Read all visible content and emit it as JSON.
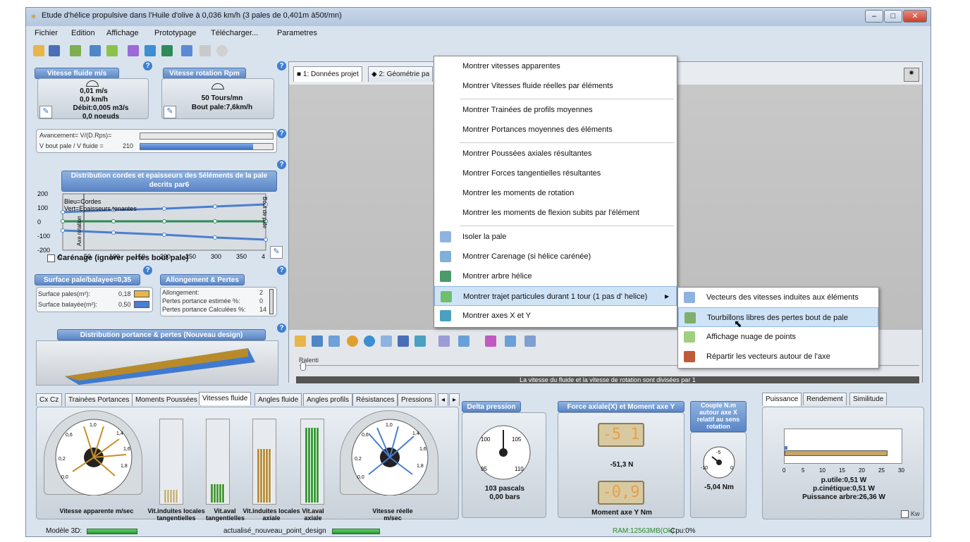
{
  "window": {
    "title": "Etude d'hélice propulsive dans l'Huile d'olive à 0,036 km/h (3 pales de 0,401m à50t/mn)",
    "menus": [
      "Fichier",
      "Edition",
      "Affichage",
      "Prototypage",
      "Télécharger...",
      "Parametres"
    ]
  },
  "fluid_speed": {
    "title": "Vitesse fluide m/s",
    "line1": "0,01 m/s",
    "line2": "0,0 km/h",
    "line3": "Débit:0,005 m3/s",
    "line4": "0,0 noeuds"
  },
  "rotation_speed": {
    "title": "Vitesse rotation Rpm",
    "line1": "50 Tours/mn",
    "line2": "Bout pale:7,6km/h"
  },
  "advance": {
    "label1": "Avancement= V/(D.Rps)=",
    "label2": "V bout pale / V fluide =",
    "value2": "210",
    "bar2_fill": 0.85
  },
  "distribution": {
    "title": "Distribution cordes et epaisseurs des 5éléments de la pale decrits par6",
    "legend1": "Bleu=Cordes",
    "legend2": "Vert=Epaisseurs tenantes",
    "yticks": [
      "200",
      "100",
      "0",
      "-100",
      "-200"
    ],
    "xticks": [
      "0",
      "50",
      "100",
      "150",
      "200",
      "250",
      "300",
      "350",
      "4"
    ],
    "left_label": "Axe rotation",
    "right_label": "Bout de pale",
    "checkbox_label": "Carénage (ignorer pertes bout pale)"
  },
  "chart_data": {
    "type": "line",
    "x": [
      0,
      100,
      200,
      300,
      400
    ],
    "series": [
      {
        "name": "Bleu=Cordes",
        "values": [
          70,
          85,
          95,
          110,
          125
        ]
      },
      {
        "name": "Vert=Epaisseurs tenantes",
        "values": [
          5,
          5,
          5,
          5,
          5
        ]
      },
      {
        "values": [
          -60,
          -75,
          -90,
          -110,
          -125
        ]
      }
    ],
    "xlim": [
      0,
      400
    ],
    "ylim": [
      -200,
      200
    ]
  },
  "surface": {
    "title": "Surface pale/balayee=0,35",
    "label1": "Surface pales(m²):",
    "value1": "0,18",
    "label2": "Surface balayée(m²):",
    "value2": "0,50"
  },
  "allongement": {
    "title": "Allongement & Pertes",
    "label1": "Allongement:",
    "value1": "2",
    "label2": "Pertes portance estimée %:",
    "value2": "0",
    "label3": "Pertes portance Calculées %:",
    "value3": "14"
  },
  "portance": {
    "title": "Distribution portance & pertes (Nouveau design)"
  },
  "viewer": {
    "tabs": [
      "1: Données projet",
      "2: Géométrie pa"
    ],
    "slider_label": "Ralenti",
    "footer": "La vitesse du fluide et la vitesse de rotation sont divisées par 1"
  },
  "context_menu": {
    "items": [
      "Montrer vitesses apparentes",
      "Montrer Vitesses fluide réelles par éléments",
      "Montrer Trainées de profils moyennes",
      "Montrer Portances  moyennes des éléments",
      "Montrer Poussées axiales résultantes",
      "Montrer Forces tangentielles résultantes",
      "Montrer les moments de rotation",
      "Montrer les moments de flexion subits par l'élément",
      "Isoler la pale",
      "Montrer Carenage (si hélice carénée)",
      "Montrer arbre hélice",
      "Montrer trajet particules durant 1 tour (1 pas d' helice)",
      "Montrer axes X et Y"
    ],
    "submenu": [
      "Vecteurs des vitesses induites aux éléments",
      "Tourbillons libres des pertes bout de pale",
      "Affichage nuage de points",
      "Répartir les vecteurs autour de l'axe"
    ]
  },
  "bottom_tabs": [
    "Cx Cz",
    "Trainées Portances",
    "Moments Poussées",
    "Vitesses fluide",
    "Angles fluide",
    "Angles profils",
    "Résistances",
    "Pressions"
  ],
  "speeds": {
    "gauge_ticks": [
      "0,0",
      "0,2",
      "0,6",
      "1,0",
      "1,4",
      "1,6",
      "1,8"
    ],
    "label_apparent": "Vitesse apparente m/sec",
    "label_ind_tan": "Vit.induites locales tangentielles",
    "label_aval_tan": "Vit.aval tangentielles",
    "label_ind_ax": "Vit.induites locales axiale",
    "label_aval_ax": "Vit.aval axiale",
    "label_real": "Vitesse réelle m/sec"
  },
  "pressure": {
    "title": "Delta pression",
    "ticks": [
      "95",
      "100",
      "105",
      "110"
    ],
    "line1": "103 pascals",
    "line2": "0,00 bars"
  },
  "force": {
    "title": "Force axiale(X) et Moment axe Y",
    "digits1": "-5 1",
    "value1": "-51,3 N",
    "digits2": "-0,9",
    "label2": "Moment axe Y Nm"
  },
  "couple": {
    "title": "Couple N.m autour axe X relatif au sens rotation",
    "ticks": [
      "-10",
      "-5",
      "0"
    ],
    "value": "-5,04 Nm"
  },
  "power": {
    "tabs": [
      "Puissance",
      "Rendement",
      "Similitude"
    ],
    "xticks": [
      "0",
      "5",
      "10",
      "15",
      "20",
      "25",
      "30"
    ],
    "line1": "p.utile:0,51 W",
    "line2": "p.cinétique:0,51 W",
    "line3": "Puissance arbre:26,36 W",
    "kw_label": "Kw"
  },
  "status": {
    "model": "Modèle 3D:",
    "updated": "actualisé_nouveau_point_design",
    "ram": "RAM:12563MB(Ok)",
    "cpu": "Cpu:0%"
  }
}
